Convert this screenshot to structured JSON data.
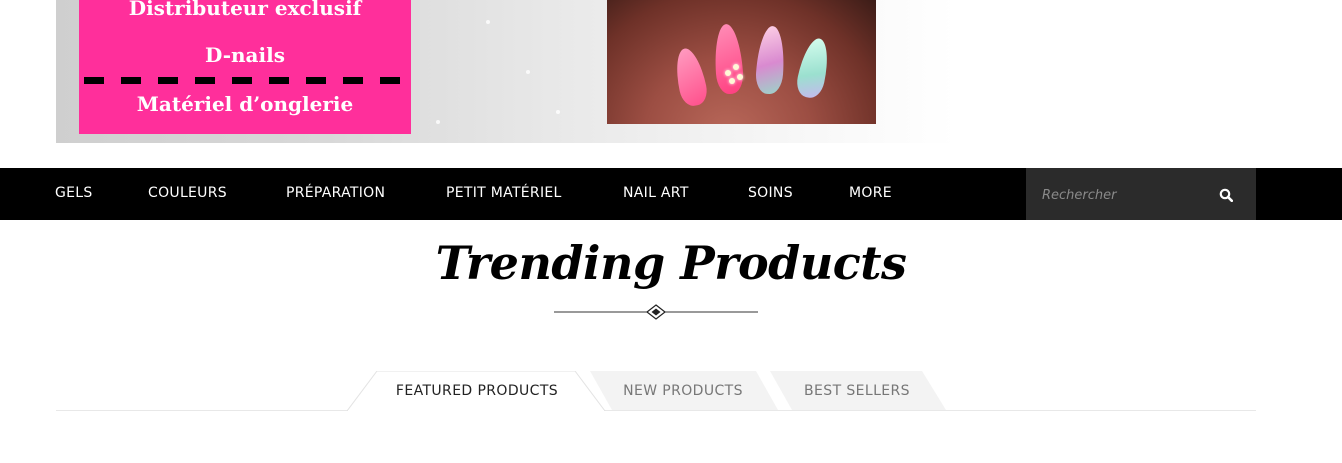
{
  "banner": {
    "line1": "Distributeur exclusif",
    "line2": "D-nails",
    "line3": "Matériel  d’onglerie"
  },
  "nav": {
    "items": [
      "GELS",
      "COULEURS",
      "PRÉPARATION",
      "PETIT MATÉRIEL",
      "NAIL ART",
      "SOINS",
      "MORE"
    ],
    "search_placeholder": "Rechercher"
  },
  "section": {
    "title": "Trending Products"
  },
  "tabs": [
    {
      "label": "FEATURED PRODUCTS",
      "active": true
    },
    {
      "label": "NEW PRODUCTS",
      "active": false
    },
    {
      "label": "BEST SELLERS",
      "active": false
    }
  ],
  "colors": {
    "pink": "#ff2f9b",
    "nav_bg": "#000000",
    "search_bg": "#2b2b2b",
    "inactive_tab_bg": "#f3f3f3"
  }
}
